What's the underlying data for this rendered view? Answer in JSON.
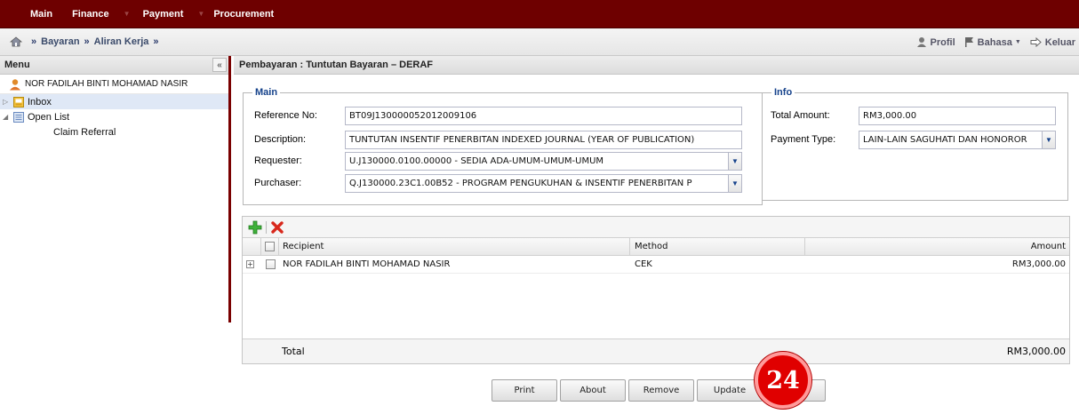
{
  "topnav": {
    "items": [
      {
        "label": "Main",
        "has_arrow": false
      },
      {
        "label": "Finance",
        "has_arrow": true
      },
      {
        "label": "Payment",
        "has_arrow": true
      },
      {
        "label": "Procurement",
        "has_arrow": false
      }
    ]
  },
  "breadcrumb": {
    "items": [
      "Bayaran",
      "Aliran Kerja"
    ],
    "separator": "»"
  },
  "rightlinks": {
    "profile": "Profil",
    "language": "Bahasa",
    "logout": "Keluar"
  },
  "menu": {
    "title": "Menu",
    "collapse_glyph": "«",
    "user": "NOR FADILAH BINTI MOHAMAD NASIR",
    "tree": [
      {
        "label": "Inbox",
        "selected": true
      },
      {
        "label": "Open List",
        "selected": false
      },
      {
        "label": "Claim Referral",
        "selected": false
      }
    ]
  },
  "main": {
    "title": "Pembayaran : Tuntutan Bayaran – DERAF",
    "section_main": {
      "legend": "Main",
      "reference_label": "Reference No:",
      "reference_value": "BT09J130000052012009106",
      "description_label": "Description:",
      "description_value": "TUNTUTAN INSENTIF PENERBITAN INDEXED JOURNAL  (YEAR OF PUBLICATION)",
      "requester_label": "Requester:",
      "requester_value": "U.J130000.0100.00000 - SEDIA ADA-UMUM-UMUM-UMUM",
      "purchaser_label": "Purchaser:",
      "purchaser_value": "Q.J130000.23C1.00B52 - PROGRAM PENGUKUHAN & INSENTIF PENERBITAN P"
    },
    "section_info": {
      "legend": "Info",
      "total_label": "Total Amount:",
      "total_value": "RM3,000.00",
      "payment_type_label": "Payment Type:",
      "payment_type_value": "LAIN-LAIN SAGUHATI DAN HONOROR"
    },
    "grid": {
      "columns": {
        "recipient": "Recipient",
        "method": "Method",
        "amount": "Amount"
      },
      "rows": [
        {
          "recipient": "NOR FADILAH BINTI MOHAMAD NASIR",
          "method": "CEK",
          "amount": "RM3,000.00"
        }
      ],
      "total_label": "Total",
      "total_value": "RM3,000.00"
    },
    "buttons": {
      "print": "Print",
      "about": "About",
      "remove": "Remove",
      "update": "Update"
    }
  },
  "step_badge": "24",
  "colors": {
    "topbar": "#6e0000",
    "legend": "#15428b",
    "badge": "#e00000",
    "selected_row": "#dfe8f6"
  }
}
